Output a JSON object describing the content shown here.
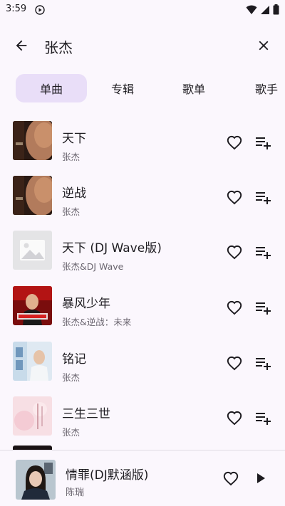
{
  "status_bar": {
    "time": "3:59"
  },
  "search": {
    "query": "张杰"
  },
  "tabs": [
    {
      "label": "单曲",
      "active": true
    },
    {
      "label": "专辑",
      "active": false
    },
    {
      "label": "歌单",
      "active": false
    },
    {
      "label": "歌手",
      "active": false
    }
  ],
  "songs": [
    {
      "title": "天下",
      "artist": "张杰",
      "cover": "face-closeup-dark"
    },
    {
      "title": "逆战",
      "artist": "张杰",
      "cover": "face-closeup-dark"
    },
    {
      "title": "天下 (DJ Wave版)",
      "artist": "张杰&DJ Wave",
      "cover": "image-placeholder-icon"
    },
    {
      "title": "暴风少年",
      "artist": "张杰&逆战：未来",
      "cover": "red-poster"
    },
    {
      "title": "铭记",
      "artist": "张杰",
      "cover": "blue-poster"
    },
    {
      "title": "三生三世",
      "artist": "张杰",
      "cover": "pink-poster"
    }
  ],
  "player": {
    "title": "情罪(DJ默涵版)",
    "artist": "陈瑞",
    "cover": "woman-portrait"
  },
  "colors": {
    "background": "#fbf7fd",
    "active_tab": "#e9def8",
    "secondary_text": "#6b6670"
  }
}
